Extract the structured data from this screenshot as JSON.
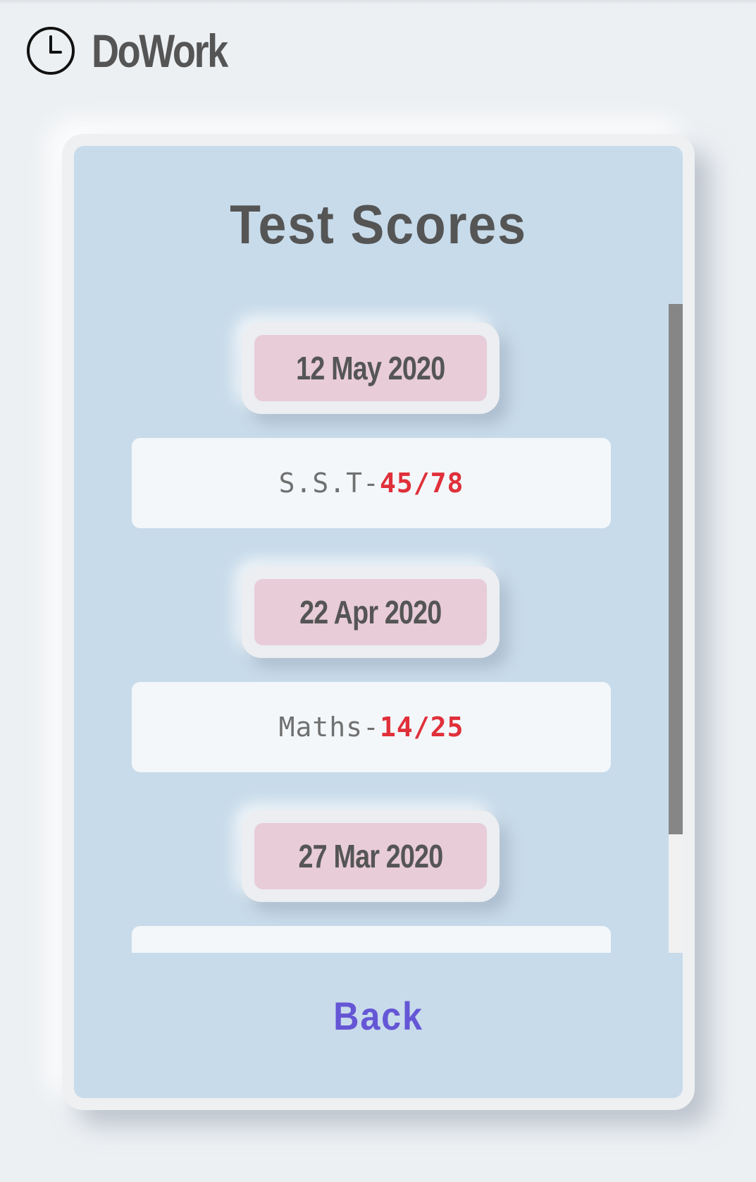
{
  "header": {
    "app_title": "DoWork",
    "icon": "clock-icon"
  },
  "card": {
    "title": "Test Scores",
    "entries": [
      {
        "date": "12 May 2020",
        "subject": "S.S.T-",
        "score": "45/78"
      },
      {
        "date": "22 Apr 2020",
        "subject": "Maths-",
        "score": "14/25"
      },
      {
        "date": "27 Mar 2020",
        "subject": "",
        "score": ""
      }
    ],
    "back_label": "Back"
  },
  "colors": {
    "background": "#edf0f3",
    "card_panel": "#c8dbea",
    "date_badge": "#e8ccd8",
    "score_highlight": "#e0303a",
    "back_link": "#6556d6",
    "heading_text": "#555555"
  }
}
